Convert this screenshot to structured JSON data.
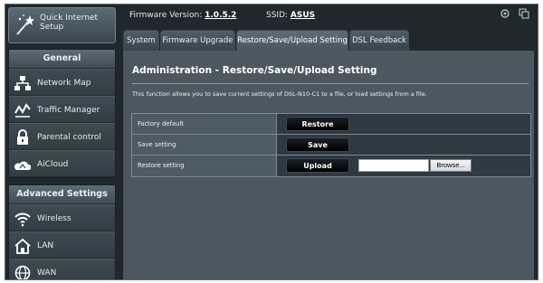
{
  "sidebar": {
    "quick_setup_label": "Quick Internet Setup",
    "general": {
      "title": "General",
      "items": [
        {
          "label": "Network Map",
          "icon": "network-map-icon"
        },
        {
          "label": "Traffic Manager",
          "icon": "traffic-manager-icon"
        },
        {
          "label": "Parental control",
          "icon": "parental-control-icon"
        },
        {
          "label": "AiCloud",
          "icon": "aicloud-icon"
        }
      ]
    },
    "advanced": {
      "title": "Advanced Settings",
      "items": [
        {
          "label": "Wireless",
          "icon": "wireless-icon"
        },
        {
          "label": "LAN",
          "icon": "lan-icon"
        },
        {
          "label": "WAN",
          "icon": "wan-icon"
        }
      ]
    }
  },
  "header": {
    "firmware_label": "Firmware Version:",
    "firmware_version": "1.0.5.2",
    "ssid_label": "SSID:",
    "ssid_value": "ASUS"
  },
  "tabs": [
    {
      "label": "System",
      "active": false
    },
    {
      "label": "Firmware Upgrade",
      "active": false
    },
    {
      "label": "Restore/Save/Upload Setting",
      "active": true
    },
    {
      "label": "DSL Feedback",
      "active": false
    }
  ],
  "main": {
    "title": "Administration - Restore/Save/Upload Setting",
    "description": "This function allows you to save current settings of DSL-N10-C1 to a file, or load settings from a file.",
    "rows": [
      {
        "label": "Factory default",
        "button": "Restore"
      },
      {
        "label": "Save setting",
        "button": "Save"
      },
      {
        "label": "Restore setting",
        "button": "Upload",
        "browse_label": "Browse..."
      }
    ]
  },
  "colors": {
    "frame": "#20282c",
    "content": "#4c575e",
    "button": "#000000"
  }
}
